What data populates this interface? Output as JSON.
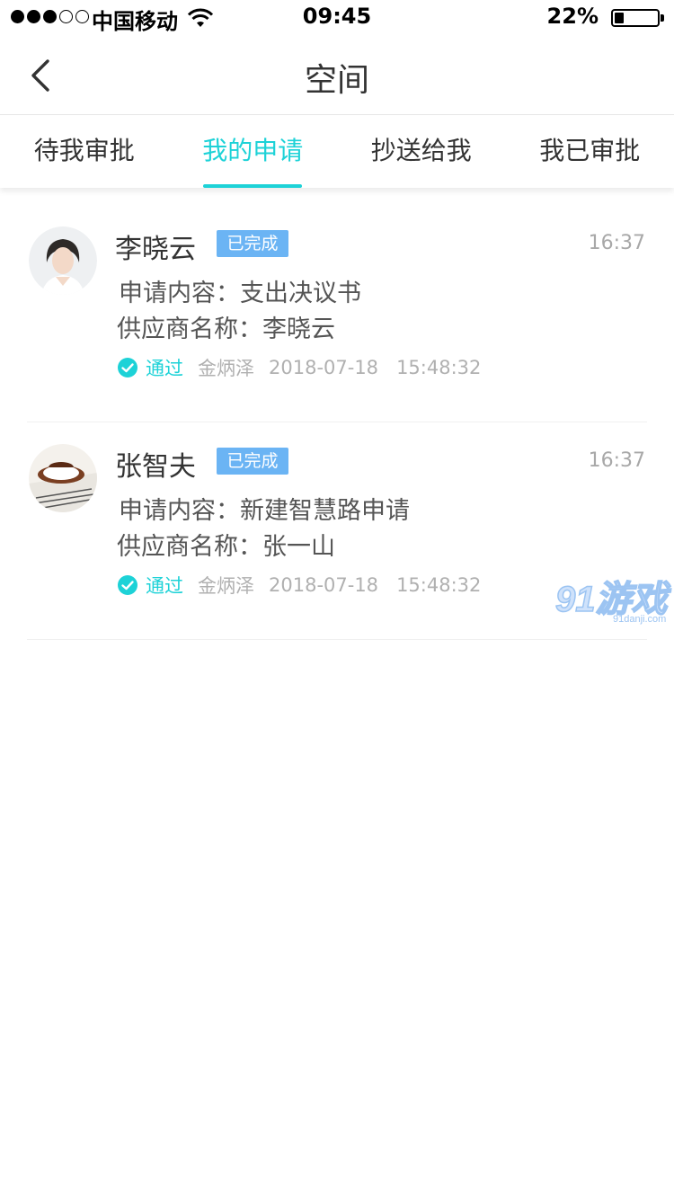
{
  "status_bar": {
    "carrier": "中国移动",
    "time": "09:45",
    "battery_percent": "22%",
    "battery_level": 0.22
  },
  "nav": {
    "title": "空间"
  },
  "tabs": [
    {
      "label": "待我审批",
      "active": false
    },
    {
      "label": "我的申请",
      "active": true
    },
    {
      "label": "抄送给我",
      "active": false
    },
    {
      "label": "我已审批",
      "active": false
    }
  ],
  "items": [
    {
      "name": "李晓云",
      "badge": "已完成",
      "time": "16:37",
      "content_label": "申请内容：",
      "content_value": "支出决议书",
      "supplier_label": "供应商名称：",
      "supplier_value": "李晓云",
      "status": "通过",
      "approver": "金炳泽",
      "datetime": "2018-07-18   15:48:32"
    },
    {
      "name": "张智夫",
      "badge": "已完成",
      "time": "16:37",
      "content_label": "申请内容：",
      "content_value": "新建智慧路申请",
      "supplier_label": "供应商名称：",
      "supplier_value": "张一山",
      "status": "通过",
      "approver": "金炳泽",
      "datetime": "2018-07-18   15:48:32"
    }
  ],
  "watermark": {
    "text": "91游戏",
    "sub": "91danji.com"
  },
  "colors": {
    "accent": "#1dd2d7",
    "badge": "#6bb4f4"
  }
}
